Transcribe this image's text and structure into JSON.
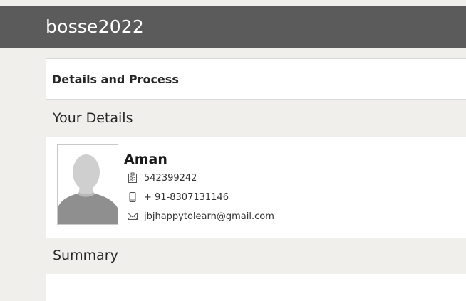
{
  "app": {
    "title": "bosse2022"
  },
  "details_card": {
    "heading": "Details and Process"
  },
  "your_details": {
    "title": "Your Details",
    "name": "Aman",
    "id_number": "542399242",
    "phone": "+ 91-8307131146",
    "email": "jbjhappytolearn@gmail.com",
    "icons": {
      "id": "id-card-icon",
      "phone": "mobile-phone-icon",
      "email": "envelope-icon",
      "avatar": "user-silhouette"
    }
  },
  "summary": {
    "title": "Summary"
  },
  "colors": {
    "header_bg": "#5b5b5b",
    "page_bg": "#f0efec",
    "panel_bg": "#ffffff",
    "avatar_fill": "#cfcfcf"
  }
}
